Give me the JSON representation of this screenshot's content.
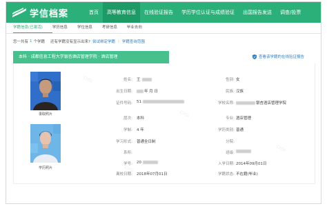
{
  "header": {
    "logo_text": "学信档案",
    "nav": [
      "首页",
      "高等教育信息",
      "在线验证报告",
      "学历学位认证与成绩验证",
      "出国报告发送",
      "调查/投票"
    ]
  },
  "subnav": [
    "学籍信息(已激活)",
    "学历信息",
    "学位信息",
    "考研信息",
    "毕业去向"
  ],
  "summary": {
    "prefix": "您一共有",
    "count": "1",
    "suffix": "个学籍",
    "question": "还有学籍没有显示出来?",
    "bind_link": "尝试绑定学籍",
    "faq_link": "学籍查询范围"
  },
  "record_title": "本科 · 成都信息工程大学银杏酒店管理学院 · 酒店管理",
  "verify_link": "查看该学籍的在线验证报告",
  "photos": [
    {
      "caption": "录取照片"
    },
    {
      "caption": "学历照片"
    }
  ],
  "fields": {
    "name": {
      "label": "姓名:",
      "value": "王"
    },
    "gender": {
      "label": "性别:",
      "value": "女"
    },
    "birth": {
      "label": "出生日期:",
      "value": "年  月  日"
    },
    "ethnicity": {
      "label": "民族:",
      "value": "汉族"
    },
    "id_no": {
      "label": "证件号码:",
      "value": "51"
    },
    "school": {
      "label": "学校名称:",
      "value": "银杏酒店管理学院"
    },
    "level": {
      "label": "层次:",
      "value": "本科"
    },
    "major": {
      "label": "专业:",
      "value": "酒店管理"
    },
    "duration": {
      "label": "学制:",
      "value": "4 年"
    },
    "category": {
      "label": "学历类别:",
      "value": "普通"
    },
    "form": {
      "label": "学习形式:",
      "value": "普通全日制"
    },
    "branch": {
      "label": "分院:",
      "value": ""
    },
    "department": {
      "label": "系所:",
      "value": ""
    },
    "class": {
      "label": "班级:",
      "value": ""
    },
    "student_no": {
      "label": "学号:",
      "value": "20"
    },
    "enroll_date": {
      "label": "入学日期:",
      "value": "2014年09月01日"
    },
    "leave_date": {
      "label": "离校日期:",
      "value": "2018年07月01日"
    },
    "status": {
      "label": "学籍状态:",
      "value": "不在籍(毕业)"
    }
  },
  "colors": {
    "brand": "#2bb079",
    "banner": "#46c08d",
    "link": "#2a7fc8"
  }
}
